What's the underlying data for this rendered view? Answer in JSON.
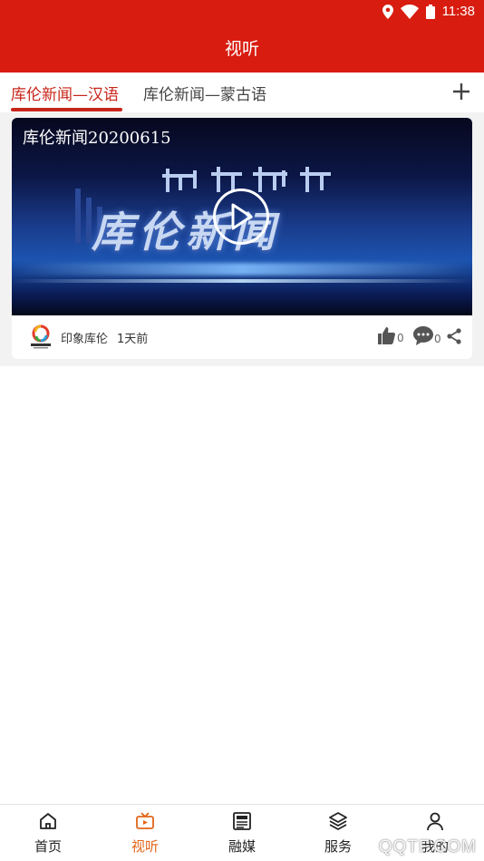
{
  "status_bar": {
    "time": "11:38",
    "icons": [
      "location-icon",
      "wifi-icon",
      "battery-icon"
    ]
  },
  "app_bar": {
    "title": "视听"
  },
  "tabs": [
    {
      "label": "库伦新闻—汉语",
      "active": true
    },
    {
      "label": "库伦新闻—蒙古语",
      "active": false
    }
  ],
  "add_tab_icon": "plus-icon",
  "feed": [
    {
      "title": "库伦新闻20200615",
      "thumbnail_text": "库伦新闻",
      "source": "印象库伦",
      "time_ago": "1天前",
      "likes": "0",
      "comments": "0"
    }
  ],
  "bottom_nav": [
    {
      "label": "首页",
      "icon": "home-icon",
      "active": false
    },
    {
      "label": "视听",
      "icon": "tv-icon",
      "active": true
    },
    {
      "label": "融媒",
      "icon": "newspaper-icon",
      "active": false
    },
    {
      "label": "服务",
      "icon": "layers-icon",
      "active": false
    },
    {
      "label": "我的",
      "icon": "user-icon",
      "active": false
    }
  ],
  "watermark": "QQTF.COM",
  "colors": {
    "brand_red": "#d91c10",
    "tab_active": "#c8251a",
    "nav_active": "#e2651a"
  }
}
